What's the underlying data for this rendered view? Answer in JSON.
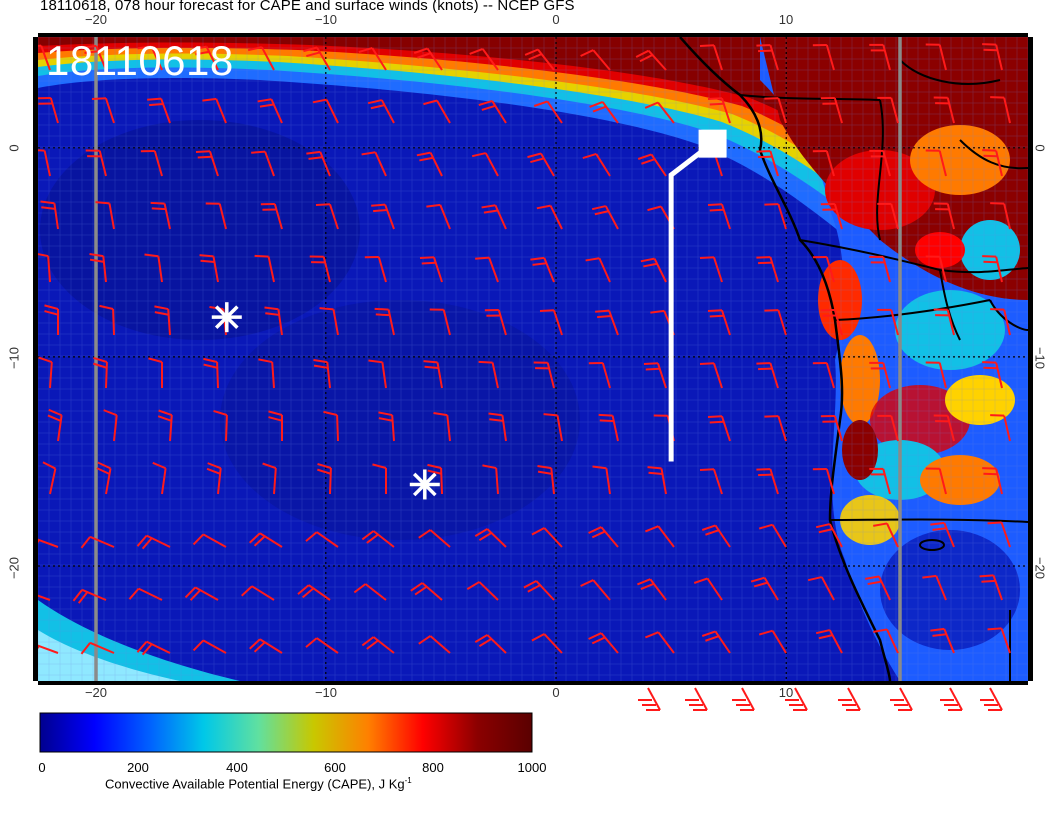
{
  "title": "18110618, 078 hour forecast for CAPE and surface winds (knots) -- NCEP GFS",
  "datetime_stamp": "18110618",
  "map": {
    "lon_ticks_top": [
      "−20",
      "−10",
      "0",
      "10"
    ],
    "lon_ticks_bottom": [
      "−20",
      "−10",
      "0",
      "10"
    ],
    "lat_ticks_left": [
      "0",
      "−10",
      "−20"
    ],
    "lat_ticks_right": [
      "0",
      "−10",
      "−20"
    ],
    "lon_range": [
      -22.5,
      20.5
    ],
    "lat_range": [
      -25.5,
      5.3
    ],
    "field": "CAPE",
    "overlay": "surface wind barbs (knots)",
    "marker_symbol": "asterisk",
    "markers": [
      {
        "lon": -14.3,
        "lat": -8.1
      },
      {
        "lon": -5.7,
        "lat": -16.1
      }
    ],
    "flight_track": [
      {
        "lon": 5.0,
        "lat": -15.0
      },
      {
        "lon": 5.0,
        "lat": -1.3
      },
      {
        "lon": 6.3,
        "lat": -0.2
      },
      {
        "lon": 6.8,
        "lat": 0.2
      }
    ],
    "track_end_marker": {
      "lon": 6.8,
      "lat": 0.2
    },
    "colors": {
      "barbs": "#ff1a1a",
      "markers": "#ffffff",
      "track": "#ffffff",
      "coast": "#000000"
    }
  },
  "colorbar": {
    "ticks": [
      "0",
      "200",
      "400",
      "600",
      "800",
      "1000"
    ],
    "min": 0,
    "max": 1000,
    "label": "Convective Available Potential Energy (CAPE), J Kg",
    "label_unit_exponent": "-1",
    "stops": [
      "#00008f",
      "#0000ff",
      "#0060ff",
      "#00c8e8",
      "#60e0a0",
      "#c8c800",
      "#ff8000",
      "#ff0000",
      "#8b0000",
      "#5a0000"
    ]
  }
}
